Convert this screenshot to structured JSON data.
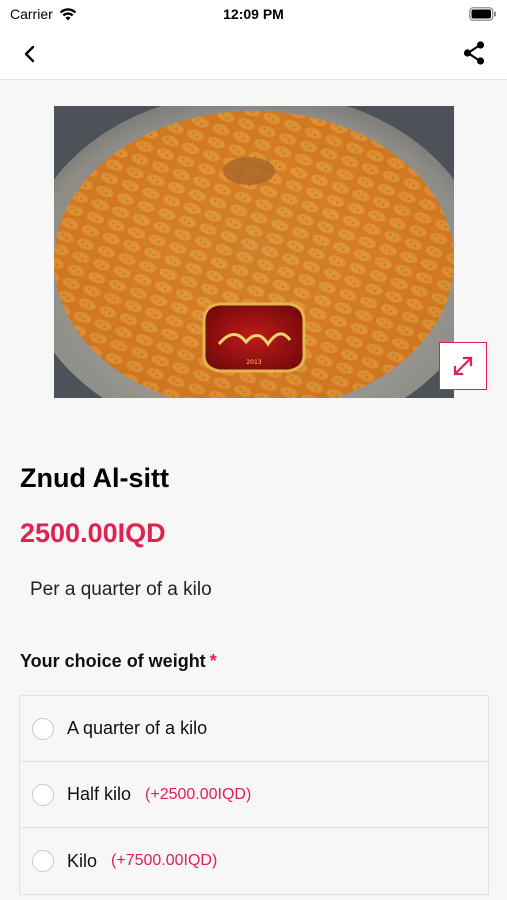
{
  "status_bar": {
    "carrier": "Carrier",
    "time": "12:09 PM"
  },
  "nav": {
    "back_icon": "chevron-left-icon",
    "share_icon": "share-icon"
  },
  "product": {
    "image_description_icon": "product-photo",
    "name": "Znud Al-sitt",
    "price": "2500.00IQD",
    "description": "Per a quarter of a kilo",
    "expand_icon": "expand-arrows-icon"
  },
  "weight_section": {
    "title": "Your choice of weight",
    "required_mark": "*",
    "options": [
      {
        "label": "A quarter of a kilo",
        "extra": ""
      },
      {
        "label": "Half kilo",
        "extra": "(+2500.00IQD)"
      },
      {
        "label": "Kilo",
        "extra": "(+7500.00IQD)"
      }
    ]
  },
  "colors": {
    "accent": "#e0224f",
    "background": "#f7f7f7"
  }
}
